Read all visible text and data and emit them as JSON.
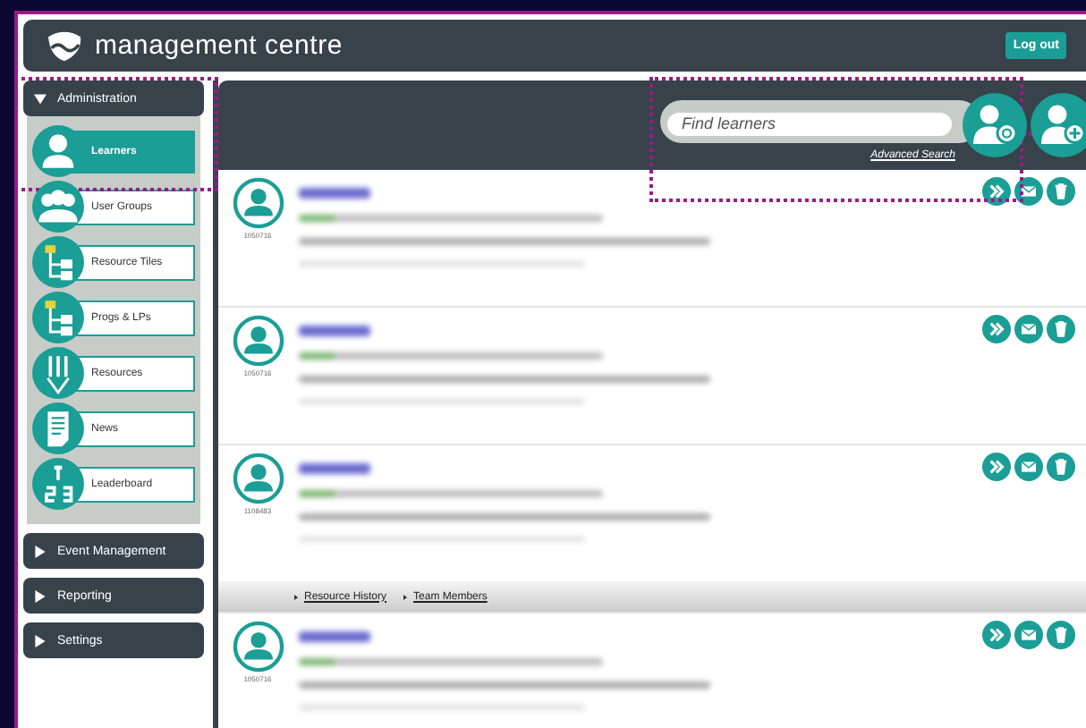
{
  "header": {
    "title": "management centre",
    "logout": "Log out"
  },
  "sidebar": {
    "sections": [
      {
        "label": "Administration",
        "expanded": true,
        "items": [
          {
            "label": "Learners",
            "kind": "person",
            "selected": true
          },
          {
            "label": "User Groups",
            "kind": "group",
            "selected": false
          },
          {
            "label": "Resource Tiles",
            "kind": "tree",
            "selected": false
          },
          {
            "label": "Progs & LPs",
            "kind": "tree",
            "selected": false
          },
          {
            "label": "Resources",
            "kind": "pencil",
            "selected": false
          },
          {
            "label": "News",
            "kind": "document",
            "selected": false
          },
          {
            "label": "Leaderboard",
            "kind": "numbers",
            "selected": false
          }
        ]
      },
      {
        "label": "Event Management",
        "expanded": false
      },
      {
        "label": "Reporting",
        "expanded": false
      },
      {
        "label": "Settings",
        "expanded": false
      }
    ]
  },
  "search": {
    "placeholder": "Find learners",
    "advanced_link": "Advanced Search"
  },
  "learners": [
    {
      "id": "1050716",
      "expanded": false
    },
    {
      "id": "1050716",
      "expanded": false
    },
    {
      "id": "1108483",
      "expanded": true,
      "links": [
        "Resource History",
        "Team Members"
      ]
    },
    {
      "id": "1050716",
      "expanded": false
    }
  ]
}
